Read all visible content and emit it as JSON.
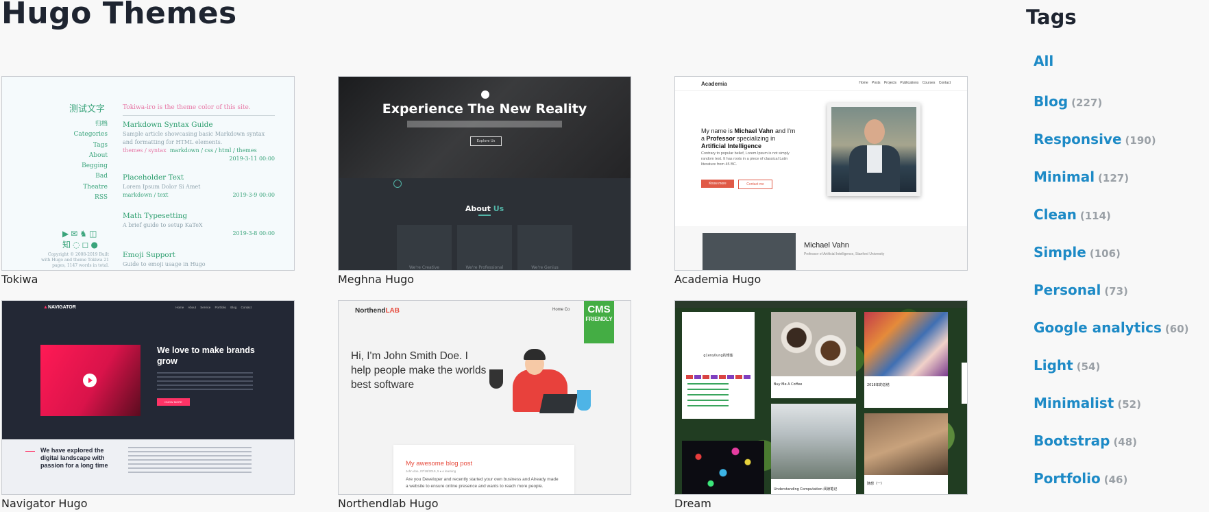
{
  "page": {
    "title": "Hugo Themes"
  },
  "themes": [
    {
      "name": "Tokiwa"
    },
    {
      "name": "Meghna Hugo"
    },
    {
      "name": "Academia Hugo"
    },
    {
      "name": "Navigator Hugo"
    },
    {
      "name": "Northendlab Hugo"
    },
    {
      "name": "Dream"
    }
  ],
  "sidebar": {
    "title": "Tags",
    "tags": [
      {
        "name": "All",
        "count": ""
      },
      {
        "name": "Blog",
        "count": "(227)"
      },
      {
        "name": "Responsive",
        "count": "(190)"
      },
      {
        "name": "Minimal",
        "count": "(127)"
      },
      {
        "name": "Clean",
        "count": "(114)"
      },
      {
        "name": "Simple",
        "count": "(106)"
      },
      {
        "name": "Personal",
        "count": "(73)"
      },
      {
        "name": "Google analytics",
        "count": "(60)"
      },
      {
        "name": "Light",
        "count": "(54)"
      },
      {
        "name": "Minimalist",
        "count": "(52)"
      },
      {
        "name": "Bootstrap",
        "count": "(48)"
      },
      {
        "name": "Portfolio",
        "count": "(46)"
      }
    ]
  },
  "previews": {
    "tokiwa": {
      "header": "测试文字",
      "message": "Tokiwa-iro is the theme color of this site.",
      "nav": [
        "归档",
        "Categories",
        "Tags",
        "About",
        "Begging",
        "Bad",
        "Theatre",
        "RSS"
      ],
      "posts": [
        {
          "title": "Markdown Syntax Guide",
          "desc": "Sample article showcasing basic Markdown syntax and formatting for HTML elements.",
          "tags1": "themes / syntax",
          "tags2": "markdown / css / html / themes",
          "date": "2019-3-11 00:00"
        },
        {
          "title": "Placeholder Text",
          "desc": "Lorem Ipsum Dolor Si Amet",
          "tags1": "",
          "tags2": "markdown / text",
          "date": "2019-3-9 00:00"
        },
        {
          "title": "Math Typesetting",
          "desc": "A brief guide to setup KaTeX",
          "tags1": "",
          "tags2": "",
          "date": "2019-3-8 00:00"
        },
        {
          "title": "Emoji Support",
          "desc": "Guide to emoji usage in Hugo",
          "tags1": "",
          "tags2": "",
          "date": ""
        }
      ],
      "footer": "Copyright © 2008-2019 Built with Hugo and theme Tokiwa 21 pages, 1147 words in total."
    },
    "meghna": {
      "headline": "Experience The New Reality",
      "button": "Explore Us",
      "about": "About",
      "about_accent": "Us",
      "boxes": [
        "We're Creative",
        "We're Professional",
        "We're Genius"
      ]
    },
    "academia": {
      "brand": "Academia",
      "menu": "Home Posts Projects Publications Courses Contact",
      "intro_pre": "My name is ",
      "intro_name": "Michael Vahn",
      "intro_mid": " and I'm a ",
      "intro_role": "Professor",
      "intro_post": " specializing in ",
      "intro_field": "Artificial Intelligence",
      "small": "Contrary to popular belief, Lorem Ipsum is not simply random text. It has roots in a piece of classical Latin literature from 45 BC.",
      "btn1": "Know more",
      "btn2": "Contact me",
      "name": "Michael Vahn",
      "role": "Professor of Artificial Intelligence, Stanford University"
    },
    "navigator": {
      "brand_accent": "▲",
      "brand": "NAVIGATOR",
      "menu": "Home About Service Portfolio Blog Contact",
      "headline": "We love to make brands grow",
      "button": "KNOW MORE",
      "lower": "We have explored the digital landscape with passion for a long time"
    },
    "northendlab": {
      "brand": "Northend",
      "brand_accent": "LAB",
      "menu": "Home   Co",
      "ribbon1": "CMS",
      "ribbon2": "FRIENDLY",
      "headline": "Hi, I'm John Smith Doe. I help people make the worlds best software",
      "post_title": "My awesome blog post",
      "post_meta": "John doe, 07/18/2019, 5 ♦ e learning",
      "post_text": "Are you Developer and recently started your own business and Already made a website to ensure online presence and wants to reach more people."
    },
    "dream": {
      "side_title": "g1eny0ung的博客",
      "card1": "Buy Me A Coffee",
      "card2": "2018年的总结",
      "card3": "Understanding Computation 阅读笔记",
      "card4": "随想（一）"
    }
  }
}
